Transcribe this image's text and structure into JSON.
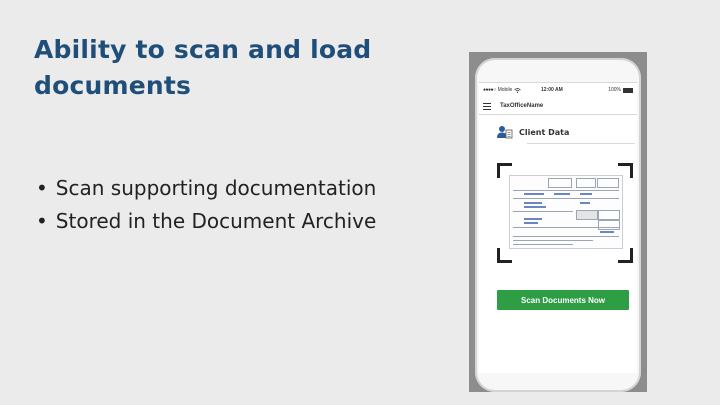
{
  "slide": {
    "title": "Ability to scan and load documents",
    "bullets": [
      "Scan supporting documentation",
      "Stored in the Document Archive"
    ]
  },
  "phone": {
    "status_bar": {
      "carrier": "Mobile",
      "time": "12:00 AM",
      "battery": "100%"
    },
    "app_bar": {
      "menu_icon": "hamburger-menu-icon",
      "app_name": "TaxOfficeName"
    },
    "section": {
      "icon": "user-document-icon",
      "label": "Client Data"
    },
    "scan_button_label": "Scan Documents Now"
  },
  "colors": {
    "title": "#1f4e79",
    "background": "#ebebeb",
    "button": "#2e9e45"
  }
}
